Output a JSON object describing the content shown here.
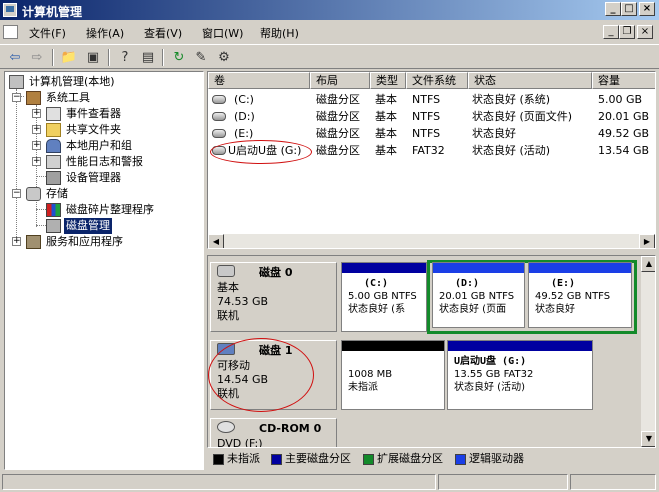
{
  "window": {
    "title": "计算机管理"
  },
  "menu": {
    "items": [
      "文件(F)",
      "操作(A)",
      "查看(V)",
      "窗口(W)",
      "帮助(H)"
    ]
  },
  "tree": {
    "root": "计算机管理(本地)",
    "system_tools": "系统工具",
    "event_viewer": "事件查看器",
    "shared_folders": "共享文件夹",
    "local_users": "本地用户和组",
    "perf_logs": "性能日志和警报",
    "device_manager": "设备管理器",
    "storage": "存储",
    "defrag": "磁盘碎片整理程序",
    "disk_mgmt": "磁盘管理",
    "services": "服务和应用程序"
  },
  "volume_list": {
    "columns": [
      "卷",
      "布局",
      "类型",
      "文件系统",
      "状态",
      "容量"
    ],
    "rows": [
      {
        "volume": "(C:)",
        "layout": "磁盘分区",
        "type": "基本",
        "fs": "NTFS",
        "status": "状态良好 (系统)",
        "capacity": "5.00 GB"
      },
      {
        "volume": "(D:)",
        "layout": "磁盘分区",
        "type": "基本",
        "fs": "NTFS",
        "status": "状态良好 (页面文件)",
        "capacity": "20.01 GB"
      },
      {
        "volume": "(E:)",
        "layout": "磁盘分区",
        "type": "基本",
        "fs": "NTFS",
        "status": "状态良好",
        "capacity": "49.52 GB"
      },
      {
        "volume": "U启动U盘 (G:)",
        "layout": "磁盘分区",
        "type": "基本",
        "fs": "FAT32",
        "status": "状态良好 (活动)",
        "capacity": "13.54 GB"
      }
    ]
  },
  "disks": [
    {
      "name": "磁盘 0",
      "type": "基本",
      "size": "74.53 GB",
      "state": "联机",
      "partitions": [
        {
          "name": "(C:)",
          "info": "5.00 GB NTFS",
          "status": "状态良好 (系"
        },
        {
          "name": "(D:)",
          "info": "20.01 GB NTFS",
          "status": "状态良好 (页面"
        },
        {
          "name": "(E:)",
          "info": "49.52 GB NTFS",
          "status": "状态良好"
        }
      ]
    },
    {
      "name": "磁盘 1",
      "type": "可移动",
      "size": "14.54 GB",
      "state": "联机",
      "partitions": [
        {
          "name": "",
          "info": "1008 MB",
          "status": "未指派"
        },
        {
          "name": "U启动U盘 (G:)",
          "info": "13.55 GB FAT32",
          "status": "状态良好 (活动)"
        }
      ]
    },
    {
      "name": "CD-ROM 0",
      "type": "DVD (F:)"
    }
  ],
  "legend": [
    "未指派",
    "主要磁盘分区",
    "扩展磁盘分区",
    "逻辑驱动器"
  ],
  "colors": {
    "unallocated": "#000000",
    "primary": "#0000a0",
    "extended": "#138a2a",
    "logical": "#1a3ee6",
    "annotation": "#d01010"
  }
}
